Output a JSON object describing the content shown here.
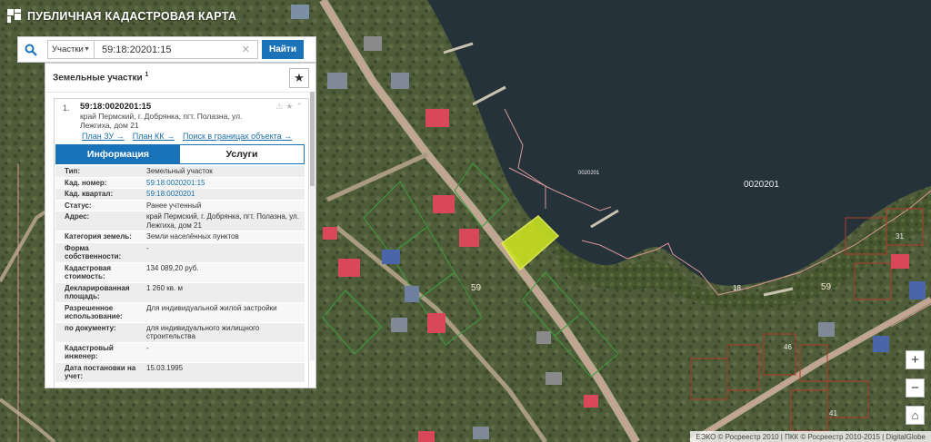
{
  "app": {
    "title": "ПУБЛИЧНАЯ КАДАСТРОВАЯ КАРТА"
  },
  "search": {
    "category": "Участки",
    "query": "59:18:20201:15",
    "button_label": "Найти"
  },
  "panel": {
    "title": "Земельные участки",
    "title_sup": "1",
    "result": {
      "number": "1.",
      "cadastral_number": "59:18:0020201:15",
      "address": "край Пермский, г. Добрянка, пгт. Полазна, ул. Лежгиха, дом 21",
      "links": [
        "План ЗУ →",
        "План КК →",
        "Поиск в границах объекта →"
      ]
    },
    "tabs": [
      "Информация",
      "Услуги"
    ],
    "rows": [
      {
        "key": "Тип:",
        "value": "Земельный участок"
      },
      {
        "key": "Кад. номер:",
        "value": "59:18:0020201:15"
      },
      {
        "key": "Кад. квартал:",
        "value": "59:18:0020201"
      },
      {
        "key": "Статус:",
        "value": "Ранее учтенный"
      },
      {
        "key": "Адрес:",
        "value": "край Пермский, г. Добрянка, пгт. Полазна, ул. Лежгиха, дом 21"
      },
      {
        "key": "Категория земель:",
        "value": "Земли населённых пунктов"
      },
      {
        "key": "Форма собственности:",
        "value": "-"
      },
      {
        "key": "Кадастровая стоимость:",
        "value": "134 089,20 руб."
      },
      {
        "key": "Декларированная площадь:",
        "value": "1 260 кв. м"
      },
      {
        "key": "Разрешенное использование:",
        "value": "Для индивидуальной жилой застройки"
      },
      {
        "key": "по документу:",
        "value": "для индивидуального жилищного строительства"
      },
      {
        "key": "Кадастровый инженер:",
        "value": "-"
      },
      {
        "key": "Дата постановки на учет:",
        "value": "15.03.1995"
      }
    ]
  },
  "map": {
    "labels": [
      "0020201",
      "0020201",
      "59",
      "59",
      "18",
      "31",
      "46",
      "41"
    ],
    "zoom_in": "+",
    "zoom_out": "−",
    "home": "⌂",
    "copyright": "ЕЭКО © Росреестр 2010 | ПКК © Росреестр 2010-2015 | DigitalGlobe"
  },
  "colors": {
    "accent": "#1a73b8",
    "parcel_highlight": "#c8e021",
    "boundary": "#e8a0a0"
  },
  "icons": [
    "logo-icon",
    "search-icon",
    "clear-icon",
    "star-icon",
    "warning-icon",
    "chevron-up-icon"
  ]
}
